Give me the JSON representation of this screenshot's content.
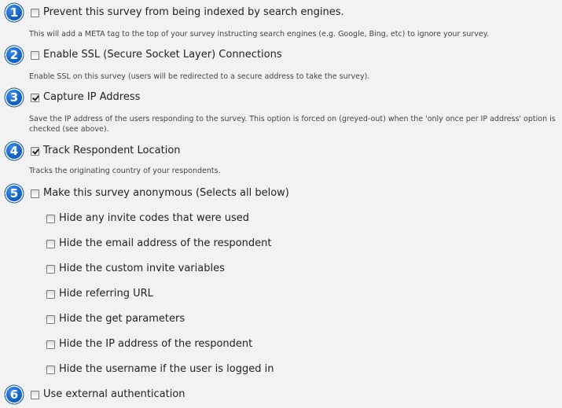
{
  "options": [
    {
      "number": "1",
      "label": "Prevent this survey from being indexed by search engines.",
      "checked": false,
      "description": "This will add a META tag to the top of your survey instructing search engines (e.g. Google, Bing, etc) to ignore your survey."
    },
    {
      "number": "2",
      "label": "Enable SSL (Secure Socket Layer) Connections",
      "checked": false,
      "description": "Enable SSL on this survey (users will be redirected to a secure address to take the survey)."
    },
    {
      "number": "3",
      "label": "Capture IP Address",
      "checked": true,
      "description": "Save the IP address of the users responding to the survey. This option is forced on (greyed-out) when the 'only once per IP address' option is checked (see above)."
    },
    {
      "number": "4",
      "label": "Track Respondent Location",
      "checked": true,
      "description": "Tracks the originating country of your respondents."
    },
    {
      "number": "5",
      "label": "Make this survey anonymous (Selects all below)",
      "checked": false
    },
    {
      "number": "6",
      "label": "Use external authentication",
      "checked": false
    }
  ],
  "anonymous_suboptions": [
    {
      "label": "Hide any invite codes that were used",
      "checked": false
    },
    {
      "label": "Hide the email address of the respondent",
      "checked": false
    },
    {
      "label": "Hide the custom invite variables",
      "checked": false
    },
    {
      "label": "Hide referring URL",
      "checked": false
    },
    {
      "label": "Hide the get parameters",
      "checked": false
    },
    {
      "label": "Hide the IP address of the respondent",
      "checked": false
    },
    {
      "label": "Hide the username if the user is logged in",
      "checked": false
    }
  ],
  "colors": {
    "badge": "#1566c8",
    "background": "#f2f2f2"
  }
}
